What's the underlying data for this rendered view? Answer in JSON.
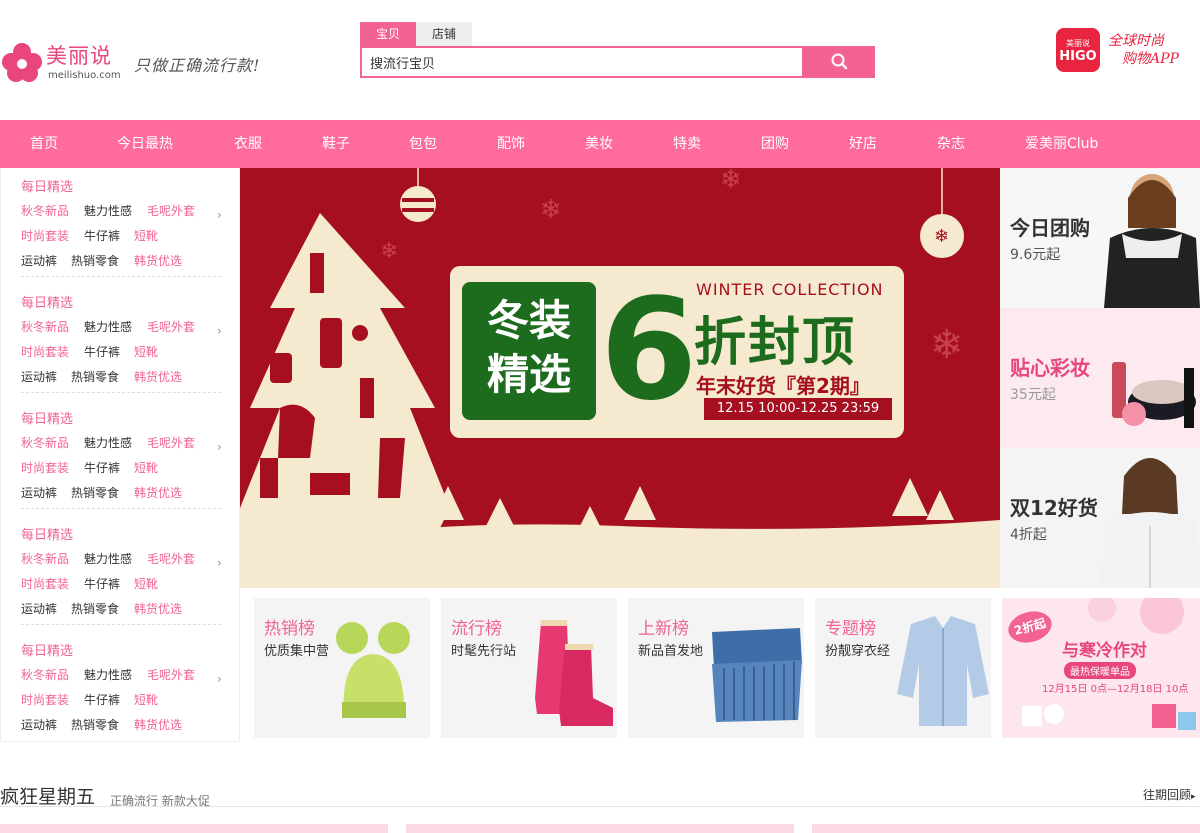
{
  "header": {
    "logo_cn": "美丽说",
    "logo_en": "meilishuo.com",
    "slogan": "只做正确流行款!",
    "search": {
      "tabs": [
        "宝贝",
        "店铺"
      ],
      "value": "搜流行宝贝"
    },
    "higo": {
      "badge_top": "美丽说",
      "badge_bottom": "HIGO",
      "line1": "全球时尚",
      "line2": "购物APP"
    }
  },
  "nav": [
    "首页",
    "今日最热",
    "衣服",
    "鞋子",
    "包包",
    "配饰",
    "美妆",
    "特卖",
    "团购",
    "好店",
    "杂志",
    "爱美丽Club"
  ],
  "categories": [
    {
      "title": "每日精选",
      "rows": [
        [
          "秋冬新品",
          "魅力性感",
          "毛呢外套"
        ],
        [
          "时尚套装",
          "牛仔裤",
          "短靴"
        ],
        [
          "运动裤",
          "热销零食",
          "韩货优选"
        ]
      ]
    },
    {
      "title": "每日精选",
      "rows": [
        [
          "秋冬新品",
          "魅力性感",
          "毛呢外套"
        ],
        [
          "时尚套装",
          "牛仔裤",
          "短靴"
        ],
        [
          "运动裤",
          "热销零食",
          "韩货优选"
        ]
      ]
    },
    {
      "title": "每日精选",
      "rows": [
        [
          "秋冬新品",
          "魅力性感",
          "毛呢外套"
        ],
        [
          "时尚套装",
          "牛仔裤",
          "短靴"
        ],
        [
          "运动裤",
          "热销零食",
          "韩货优选"
        ]
      ]
    },
    {
      "title": "每日精选",
      "rows": [
        [
          "秋冬新品",
          "魅力性感",
          "毛呢外套"
        ],
        [
          "时尚套装",
          "牛仔裤",
          "短靴"
        ],
        [
          "运动裤",
          "热销零食",
          "韩货优选"
        ]
      ]
    },
    {
      "title": "每日精选",
      "rows": [
        [
          "秋冬新品",
          "魅力性感",
          "毛呢外套"
        ],
        [
          "时尚套装",
          "牛仔裤",
          "短靴"
        ],
        [
          "运动裤",
          "热销零食",
          "韩货优选"
        ]
      ]
    }
  ],
  "banner": {
    "box_line1": "冬装",
    "box_line2": "精选",
    "big_number": "6",
    "winter": "WINTER COLLECTION",
    "headline": "折封顶",
    "subline": "年末好货『第2期』",
    "dates": "12.15 10:00-12.25 23:59"
  },
  "promos": [
    {
      "title": "今日团购",
      "sub": "9.6元起"
    },
    {
      "title": "贴心彩妆",
      "sub": "35元起"
    },
    {
      "title": "双12好货",
      "sub": "4折起"
    }
  ],
  "tiles": [
    {
      "title": "热销榜",
      "sub": "优质集中营"
    },
    {
      "title": "流行榜",
      "sub": "时髦先行站"
    },
    {
      "title": "上新榜",
      "sub": "新品首发地"
    },
    {
      "title": "专题榜",
      "sub": "扮靓穿衣经"
    }
  ],
  "ad": {
    "bubble": "2折起",
    "title": "与寒冷作对",
    "sub": "最热保暖单品",
    "dates": "12月15日 0点—12月18日 10点"
  },
  "section": {
    "title": "疯狂星期五",
    "sub": "正确流行 新款大促",
    "link": "往期回顾"
  },
  "colors": {
    "brand_pink": "#f26392",
    "nav_pink": "#ff6b9b",
    "banner_red": "#a50f1f",
    "banner_green": "#1d6b1d"
  }
}
